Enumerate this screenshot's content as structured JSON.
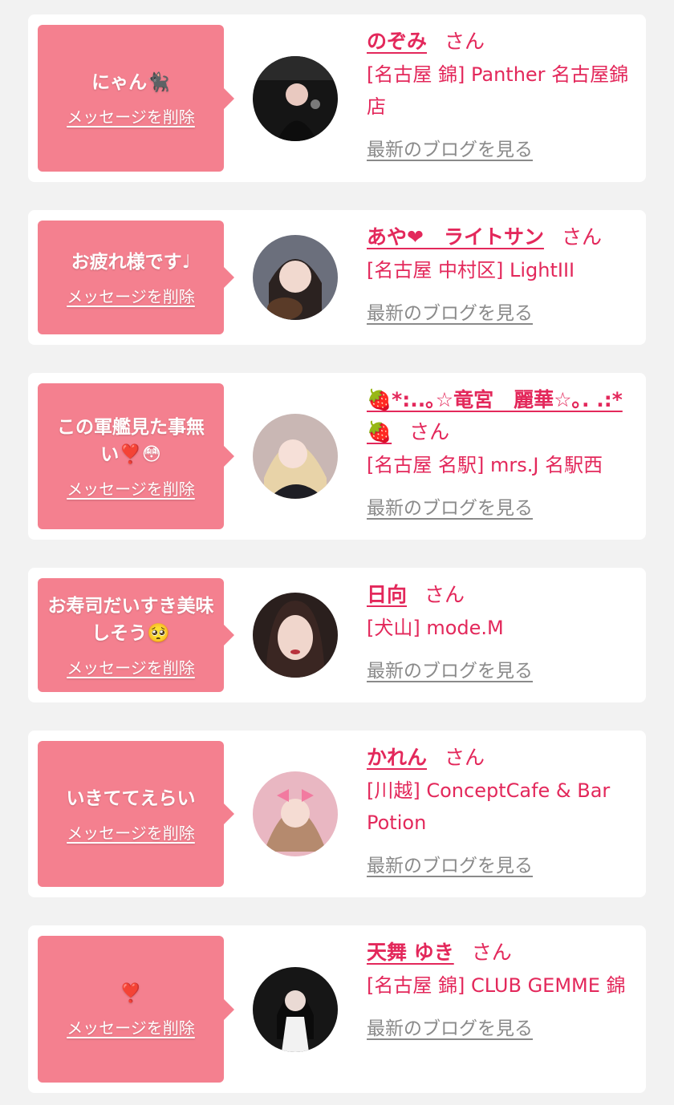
{
  "delete_label": "メッセージを削除",
  "blog_label": "最新のブログを見る",
  "san_label": "さん",
  "colors": {
    "accent": "#e3285b",
    "bubble": "#f4808f",
    "background": "#f2f2f2",
    "link_gray": "#8a8a8a"
  },
  "items": [
    {
      "message": "にゃん🐈‍⬛",
      "name": "のぞみ",
      "shop": "[名古屋 錦] Panther 名古屋錦店",
      "avatar": "profile-photo-nozomi"
    },
    {
      "message": "お疲れ様です♩",
      "name": "あや❤︎　ライトサン",
      "shop": "[名古屋 中村区] LightIII",
      "avatar": "profile-photo-aya"
    },
    {
      "message": "この軍艦見た事無い❣️😳",
      "name": "🍓*:..｡☆竜宮　麗華☆｡. .:*🍓",
      "shop": "[名古屋 名駅] mrs.J 名駅西",
      "avatar": "profile-photo-reika"
    },
    {
      "message": "お寿司だいすき美味しそう🥺",
      "name": "日向",
      "shop": "[犬山] mode.M",
      "avatar": "profile-photo-hinata"
    },
    {
      "message": "いきててえらい",
      "name": "かれん",
      "shop": "[川越] ConceptCafe & Bar Potion",
      "avatar": "profile-photo-karen"
    },
    {
      "message": "❣️",
      "name": "天舞 ゆき",
      "shop": "[名古屋 錦] CLUB GEMME 錦",
      "avatar": "profile-photo-yuki"
    }
  ]
}
